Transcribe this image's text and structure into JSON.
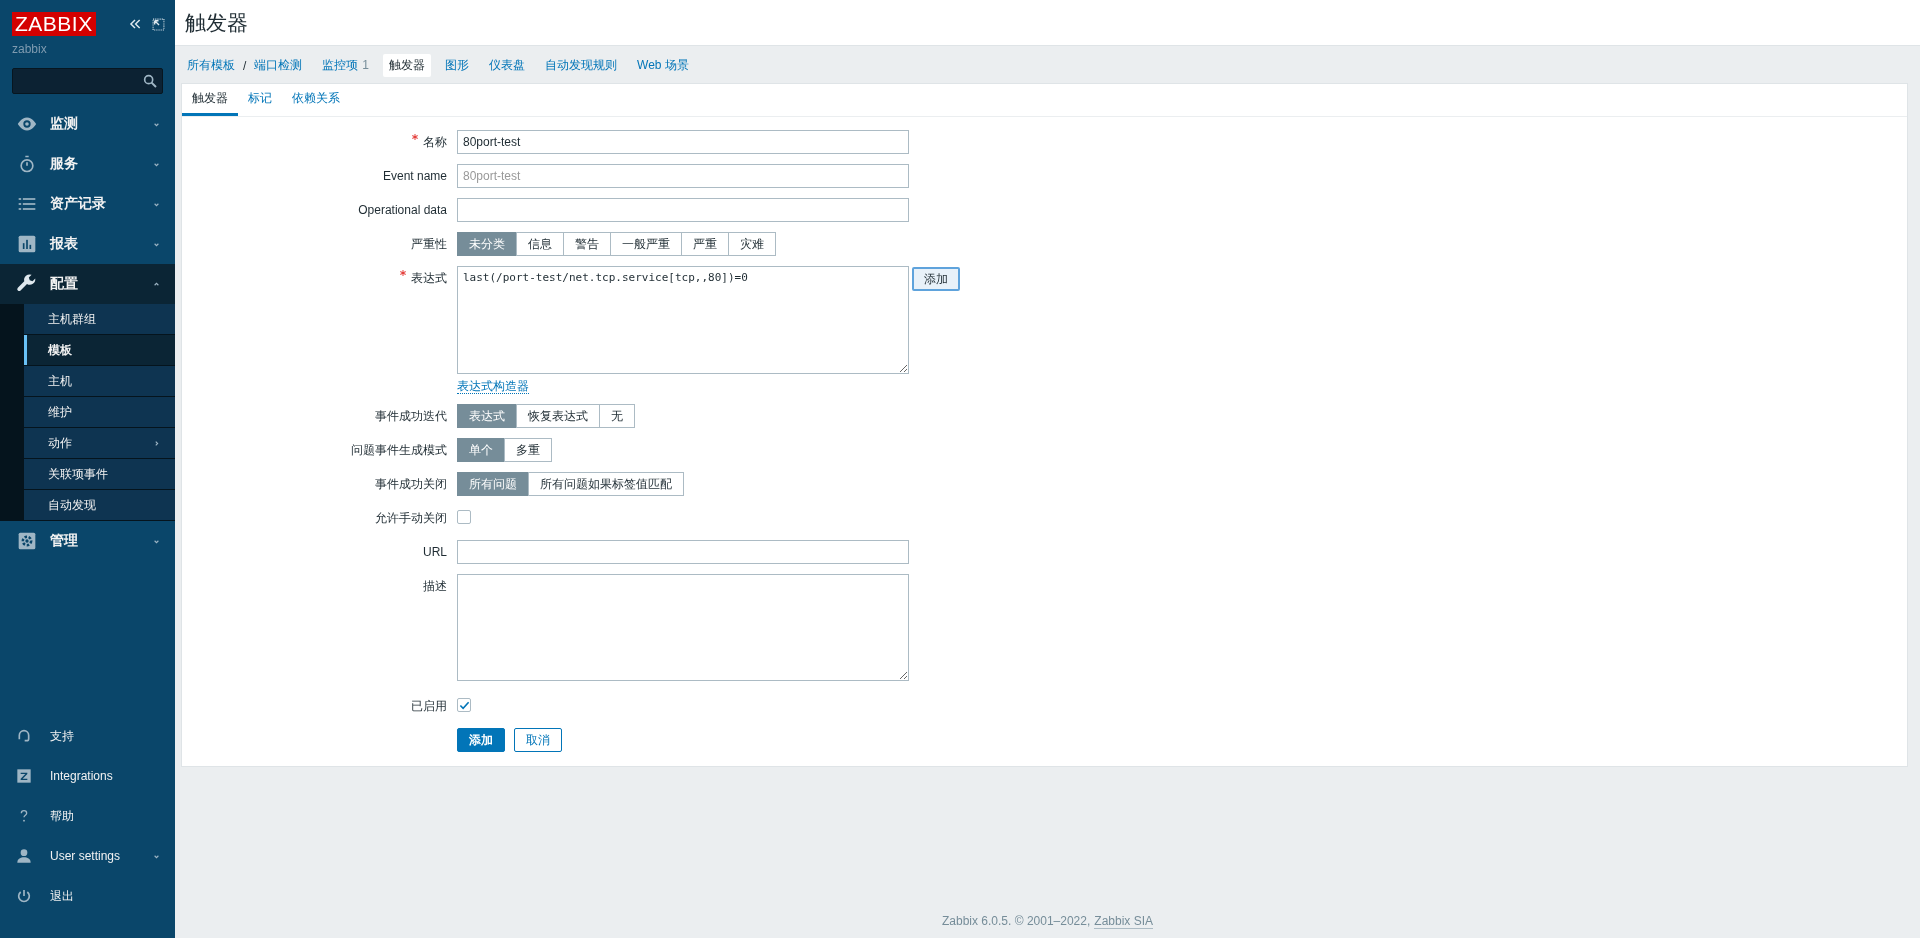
{
  "sidebar": {
    "logo": "ZABBIX",
    "server_name": "zabbix",
    "menu": [
      {
        "label": "监测",
        "expanded": false
      },
      {
        "label": "服务",
        "expanded": false
      },
      {
        "label": "资产记录",
        "expanded": false
      },
      {
        "label": "报表",
        "expanded": false
      },
      {
        "label": "配置",
        "expanded": true,
        "children": [
          {
            "label": "主机群组",
            "selected": false,
            "submenu": false
          },
          {
            "label": "模板",
            "selected": true,
            "submenu": false
          },
          {
            "label": "主机",
            "selected": false,
            "submenu": false
          },
          {
            "label": "维护",
            "selected": false,
            "submenu": false
          },
          {
            "label": "动作",
            "selected": false,
            "submenu": true
          },
          {
            "label": "关联项事件",
            "selected": false,
            "submenu": false
          },
          {
            "label": "自动发现",
            "selected": false,
            "submenu": false
          }
        ]
      },
      {
        "label": "管理",
        "expanded": false
      }
    ],
    "bottom_menu": [
      {
        "label": "支持",
        "dropdown": false
      },
      {
        "label": "Integrations",
        "dropdown": false
      },
      {
        "label": "帮助",
        "dropdown": false
      },
      {
        "label": "User settings",
        "dropdown": true
      },
      {
        "label": "退出",
        "dropdown": false
      }
    ]
  },
  "page_title": "触发器",
  "breadcrumbs": {
    "items": [
      "所有模板",
      "端口检测"
    ],
    "separator": "/"
  },
  "nav_tabs": [
    {
      "label": "监控项",
      "count": "1",
      "selected": false
    },
    {
      "label": "触发器",
      "selected": true
    },
    {
      "label": "图形",
      "selected": false
    },
    {
      "label": "仪表盘",
      "selected": false
    },
    {
      "label": "自动发现规则",
      "selected": false
    },
    {
      "label": "Web 场景",
      "selected": false
    }
  ],
  "tabs": [
    {
      "label": "触发器",
      "selected": true
    },
    {
      "label": "标记",
      "selected": false
    },
    {
      "label": "依赖关系",
      "selected": false
    }
  ],
  "fields": [
    {
      "kind": "text",
      "label": "名称",
      "required": true,
      "value": "80port-test"
    },
    {
      "kind": "text",
      "label": "Event name",
      "required": false,
      "placeholder": "80port-test"
    },
    {
      "kind": "text",
      "label": "Operational data",
      "required": false
    },
    {
      "kind": "segmented",
      "label": "严重性",
      "required": false,
      "options": [
        {
          "label": "未分类",
          "selected": true
        },
        {
          "label": "信息",
          "selected": false
        },
        {
          "label": "警告",
          "selected": false
        },
        {
          "label": "一般严重",
          "selected": false
        },
        {
          "label": "严重",
          "selected": false
        },
        {
          "label": "灾难",
          "selected": false
        }
      ]
    },
    {
      "kind": "expression",
      "label": "表达式",
      "required": true,
      "value": "last(/port-test/net.tcp.service[tcp,,80])=0",
      "button": "添加",
      "link": "表达式构造器"
    },
    {
      "kind": "segmented",
      "label": "事件成功迭代",
      "required": false,
      "options": [
        {
          "label": "表达式",
          "selected": true
        },
        {
          "label": "恢复表达式",
          "selected": false
        },
        {
          "label": "无",
          "selected": false
        }
      ]
    },
    {
      "kind": "segmented",
      "label": "问题事件生成模式",
      "required": false,
      "options": [
        {
          "label": "单个",
          "selected": true
        },
        {
          "label": "多重",
          "selected": false
        }
      ]
    },
    {
      "kind": "segmented",
      "label": "事件成功关闭",
      "required": false,
      "options": [
        {
          "label": "所有问题",
          "selected": true
        },
        {
          "label": "所有问题如果标签值匹配",
          "selected": false
        }
      ]
    },
    {
      "kind": "checkbox",
      "label": "允许手动关闭",
      "required": false,
      "checked": false
    },
    {
      "kind": "text",
      "label": "URL",
      "required": false
    },
    {
      "kind": "textarea",
      "label": "描述",
      "required": false
    },
    {
      "kind": "checkbox",
      "label": "已启用",
      "required": false,
      "checked": true
    }
  ],
  "actions": [
    {
      "label": "添加",
      "kind": "primary"
    },
    {
      "label": "取消",
      "kind": "secondary"
    }
  ],
  "footer": {
    "text": "Zabbix 6.0.5. © 2001–2022,",
    "link": "Zabbix SIA"
  }
}
